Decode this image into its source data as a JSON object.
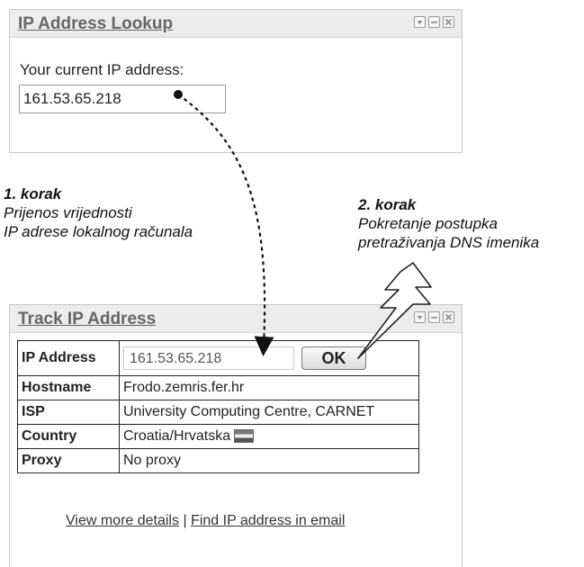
{
  "lookup_widget": {
    "title": "IP Address Lookup",
    "label": "Your current IP address:",
    "ip_value": "161.53.65.218"
  },
  "track_widget": {
    "title": "Track IP Address",
    "rows": [
      {
        "key": "IP Address",
        "value": "161.53.65.218"
      },
      {
        "key": "Hostname",
        "value": "Frodo.zemris.fer.hr"
      },
      {
        "key": "ISP",
        "value": "University Computing Centre, CARNET"
      },
      {
        "key": "Country",
        "value": "Croatia/Hrvatska"
      },
      {
        "key": "Proxy",
        "value": "No proxy"
      }
    ],
    "ok_label": "OK",
    "link_details": "View more details",
    "link_separator": "|",
    "link_email": "Find IP address in email"
  },
  "annotations": {
    "step1_title": "1. korak",
    "step1_line1": "Prijenos vrijednosti",
    "step1_line2": "IP adrese lokalnog računala",
    "step2_title": "2. korak",
    "step2_line1": "Pokretanje postupka",
    "step2_line2": "pretraživanja DNS imenika"
  },
  "icons": {
    "window_controls": [
      "dropdown-icon",
      "minimize-icon",
      "close-icon"
    ],
    "flag": "croatia-flag-icon",
    "lightning": "lightning-icon"
  },
  "colors": {
    "header_bg": "#ececec",
    "title_text": "#666666",
    "border": "#c9c9c9"
  }
}
